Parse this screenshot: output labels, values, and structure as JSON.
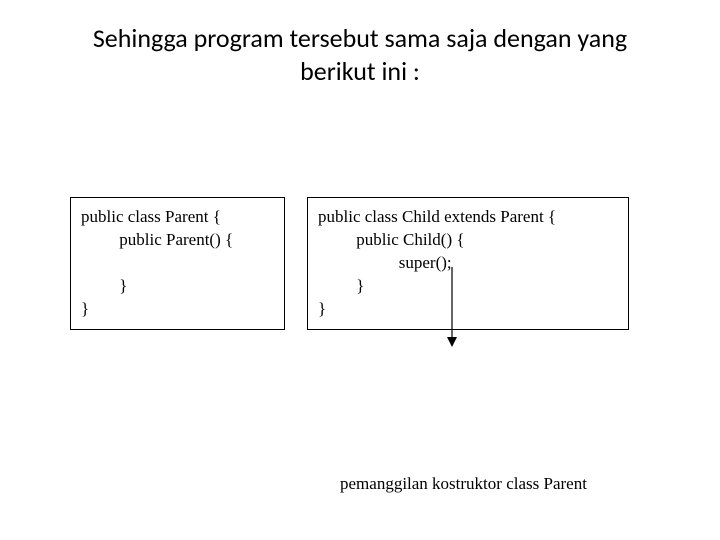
{
  "slide": {
    "title": "Sehingga program tersebut sama saja dengan yang berikut ini :"
  },
  "code": {
    "parent": "public class Parent {\n         public Parent() {\n\n         }\n}",
    "child": "public class Child extends Parent {\n         public Child() {\n                   super();\n         }\n}"
  },
  "caption": "pemanggilan kostruktor class Parent"
}
